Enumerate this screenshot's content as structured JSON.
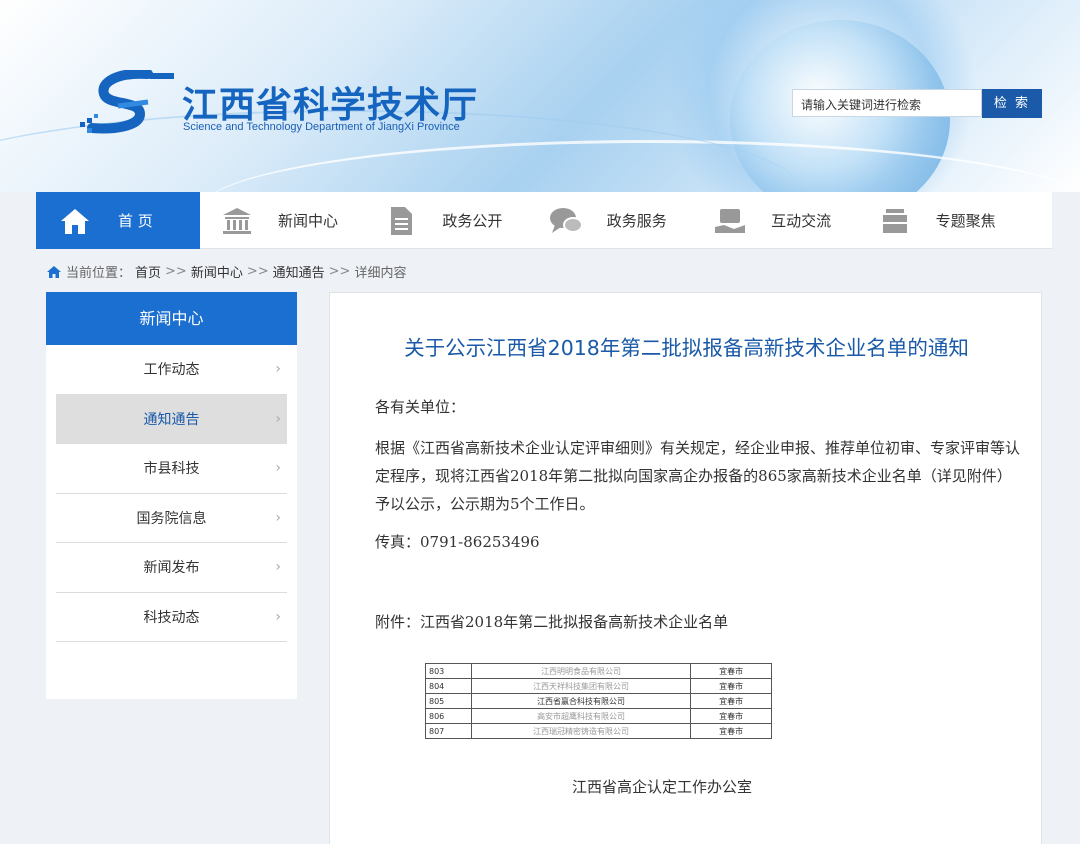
{
  "header": {
    "title": "江西省科学技术厅",
    "subtitle": "Science and Technology Department of JiangXi Province",
    "search_placeholder": "请输入关键词进行检索",
    "search_button": "检 索"
  },
  "nav": {
    "items": [
      {
        "label": "首 页",
        "icon": "home-icon"
      },
      {
        "label": "新闻中心",
        "icon": "building-icon"
      },
      {
        "label": "政务公开",
        "icon": "document-icon"
      },
      {
        "label": "政务服务",
        "icon": "chat-icon"
      },
      {
        "label": "互动交流",
        "icon": "handshake-icon"
      },
      {
        "label": "专题聚焦",
        "icon": "stack-icon"
      }
    ]
  },
  "breadcrumb": {
    "prefix": "当前位置：",
    "items": [
      "首页",
      "新闻中心",
      "通知通告",
      "详细内容"
    ],
    "separator": ">>"
  },
  "sidebar": {
    "heading": "新闻中心",
    "items": [
      "工作动态",
      "通知通告",
      "市县科技",
      "国务院信息",
      "新闻发布",
      "科技动态"
    ],
    "active": "通知通告"
  },
  "article": {
    "title": "关于公示江西省2018年第二批拟报备高新技术企业名单的通知",
    "salutation": "各有关单位：",
    "body": "根据《江西省高新技术企业认定评审细则》有关规定，经企业申报、推荐单位初审、专家评审等认定程序，现将江西省2018年第二批拟向国家高企办报备的865家高新技术企业名单（详见附件）予以公示，公示期为5个工作日。",
    "fax": "传真：0791-86253496",
    "attachment": "附件：江西省2018年第二批拟报备高新技术企业名单",
    "signature": "江西省高企认定工作办公室",
    "table_rows": [
      {
        "no": "803",
        "name": "江西明明食品有限公司",
        "city": "宜春市",
        "dark": false
      },
      {
        "no": "804",
        "name": "江西天祥科技集团有限公司",
        "city": "宜春市",
        "dark": false
      },
      {
        "no": "805",
        "name": "江西省赢合科技有限公司",
        "city": "宜春市",
        "dark": true
      },
      {
        "no": "806",
        "name": "高安市超鹰科技有限公司",
        "city": "宜春市",
        "dark": false
      },
      {
        "no": "807",
        "name": "江西瑞冠精密铸造有限公司",
        "city": "宜春市",
        "dark": false
      }
    ]
  }
}
